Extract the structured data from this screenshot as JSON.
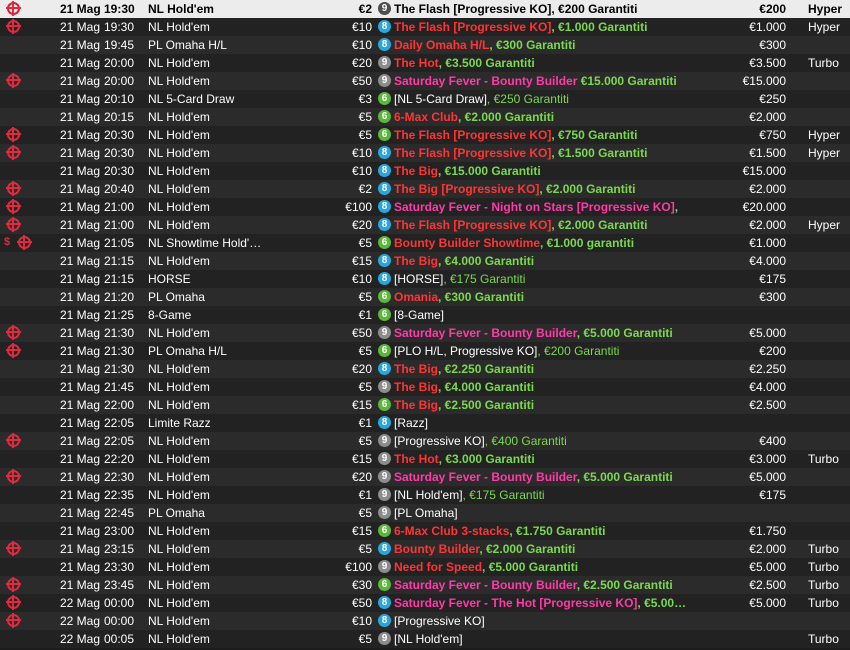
{
  "colors": {
    "seat_9": "#8c8c8c",
    "seat_8": "#29a7dc",
    "seat_6": "#5cb63a",
    "name_red": "#ff3535",
    "name_pink": "#ff3ba8",
    "guarantee_green": "#7cd94f",
    "reticle_red": "#e02a3e"
  },
  "rows": [
    {
      "reticle": true,
      "day": "21 Mag",
      "time": "19:30",
      "game": "NL Hold'em",
      "buyin": "€2",
      "seats": "9",
      "name": "The Flash [Progressive KO]",
      "suffix": ", €200 Garantiti",
      "name_style": "dark",
      "suffix_style": "dark",
      "gtd": "€200",
      "type": "Hyper",
      "selected": true
    },
    {
      "reticle": true,
      "day": "21 Mag",
      "time": "19:30",
      "game": "NL Hold'em",
      "buyin": "€10",
      "seats": "8",
      "name": "The Flash [Progressive KO]",
      "suffix": ", €1.000 Garantiti",
      "name_style": "red",
      "suffix_style": "green",
      "gtd": "€1.000",
      "type": "Hyper"
    },
    {
      "day": "21 Mag",
      "time": "19:45",
      "game": "PL Omaha H/L",
      "buyin": "€10",
      "seats": "8",
      "name": "Daily Omaha H/L",
      "suffix": ", €300 Garantiti",
      "name_style": "red",
      "suffix_style": "green",
      "gtd": "€300",
      "type": ""
    },
    {
      "day": "21 Mag",
      "time": "20:00",
      "game": "NL Hold'em",
      "buyin": "€20",
      "seats": "9",
      "name": "The Hot",
      "suffix": ", €3.500 Garantiti",
      "name_style": "red",
      "suffix_style": "green",
      "gtd": "€3.500",
      "type": "Turbo"
    },
    {
      "reticle": true,
      "day": "21 Mag",
      "time": "20:00",
      "game": "NL Hold'em",
      "buyin": "€50",
      "seats": "9",
      "name": "Saturday Fever - Bounty Builder",
      "suffix": " €15.000 Garantiti",
      "name_style": "pink",
      "suffix_style": "green",
      "gtd": "€15.000",
      "type": ""
    },
    {
      "day": "21 Mag",
      "time": "20:10",
      "game": "NL 5-Card Draw",
      "buyin": "€3",
      "seats": "6",
      "name": "[NL 5-Card Draw]",
      "suffix": ", €250 Garantiti",
      "name_style": "white",
      "suffix_style": "lite",
      "gtd": "€250",
      "type": ""
    },
    {
      "day": "21 Mag",
      "time": "20:15",
      "game": "NL Hold'em",
      "buyin": "€5",
      "seats": "6",
      "name": "6-Max Club",
      "suffix": ", €2.000 Garantiti",
      "name_style": "red",
      "suffix_style": "green",
      "gtd": "€2.000",
      "type": ""
    },
    {
      "reticle": true,
      "day": "21 Mag",
      "time": "20:30",
      "game": "NL Hold'em",
      "buyin": "€5",
      "seats": "6",
      "name": "The Flash [Progressive KO]",
      "suffix": ", €750 Garantiti",
      "name_style": "red",
      "suffix_style": "green",
      "gtd": "€750",
      "type": "Hyper"
    },
    {
      "reticle": true,
      "day": "21 Mag",
      "time": "20:30",
      "game": "NL Hold'em",
      "buyin": "€10",
      "seats": "8",
      "name": "The Flash [Progressive KO]",
      "suffix": ", €1.500 Garantiti",
      "name_style": "red",
      "suffix_style": "green",
      "gtd": "€1.500",
      "type": "Hyper"
    },
    {
      "day": "21 Mag",
      "time": "20:30",
      "game": "NL Hold'em",
      "buyin": "€10",
      "seats": "8",
      "name": "The Big",
      "suffix": ", €15.000 Garantiti",
      "name_style": "red",
      "suffix_style": "green",
      "gtd": "€15.000",
      "type": ""
    },
    {
      "reticle": true,
      "day": "21 Mag",
      "time": "20:40",
      "game": "NL Hold'em",
      "buyin": "€2",
      "seats": "8",
      "name": "The Big [Progressive KO]",
      "suffix": ", €2.000 Garantiti",
      "name_style": "red",
      "suffix_style": "green",
      "gtd": "€2.000",
      "type": ""
    },
    {
      "reticle": true,
      "day": "21 Mag",
      "time": "21:00",
      "game": "NL Hold'em",
      "buyin": "€100",
      "seats": "8",
      "name": "Saturday Fever - Night on Stars [Progressive KO]",
      "suffix": ",",
      "name_style": "pink",
      "suffix_style": "green",
      "gtd": "€20.000",
      "type": ""
    },
    {
      "reticle": true,
      "day": "21 Mag",
      "time": "21:00",
      "game": "NL Hold'em",
      "buyin": "€20",
      "seats": "8",
      "name": "The Flash [Progressive KO]",
      "suffix": ", €2.000 Garantiti",
      "name_style": "red",
      "suffix_style": "green",
      "gtd": "€2.000",
      "type": "Hyper"
    },
    {
      "reticle": true,
      "bounty": "$",
      "day": "21 Mag",
      "time": "21:05",
      "game": "NL Showtime Hold'…",
      "buyin": "€5",
      "seats": "6",
      "name": "Bounty Builder Showtime",
      "suffix": ", €1.000 garantiti",
      "name_style": "red",
      "suffix_style": "green",
      "gtd": "€1.000",
      "type": ""
    },
    {
      "day": "21 Mag",
      "time": "21:15",
      "game": "NL Hold'em",
      "buyin": "€15",
      "seats": "8",
      "name": "The Big",
      "suffix": ", €4.000 Garantiti",
      "name_style": "red",
      "suffix_style": "green",
      "gtd": "€4.000",
      "type": ""
    },
    {
      "day": "21 Mag",
      "time": "21:15",
      "game": "HORSE",
      "buyin": "€10",
      "seats": "8",
      "name": "[HORSE]",
      "suffix": ", €175 Garantiti",
      "name_style": "white",
      "suffix_style": "lite",
      "gtd": "€175",
      "type": ""
    },
    {
      "day": "21 Mag",
      "time": "21:20",
      "game": "PL Omaha",
      "buyin": "€5",
      "seats": "6",
      "name": "Omania",
      "suffix": ", €300 Garantiti",
      "name_style": "red",
      "suffix_style": "green",
      "gtd": "€300",
      "type": ""
    },
    {
      "day": "21 Mag",
      "time": "21:25",
      "game": "8-Game",
      "buyin": "€1",
      "seats": "6",
      "name": "[8-Game]",
      "suffix": "",
      "name_style": "white",
      "suffix_style": "lite",
      "gtd": "",
      "type": ""
    },
    {
      "reticle": true,
      "day": "21 Mag",
      "time": "21:30",
      "game": "NL Hold'em",
      "buyin": "€50",
      "seats": "9",
      "name": "Saturday Fever - Bounty Builder",
      "suffix": ", €5.000 Garantiti",
      "name_style": "pink",
      "suffix_style": "green",
      "gtd": "€5.000",
      "type": ""
    },
    {
      "reticle": true,
      "day": "21 Mag",
      "time": "21:30",
      "game": "PL Omaha H/L",
      "buyin": "€5",
      "seats": "6",
      "name": "[PLO H/L, Progressive KO]",
      "suffix": ", €200 Garantiti",
      "name_style": "white",
      "suffix_style": "lite",
      "gtd": "€200",
      "type": ""
    },
    {
      "day": "21 Mag",
      "time": "21:30",
      "game": "NL Hold'em",
      "buyin": "€20",
      "seats": "8",
      "name": "The Big",
      "suffix": ", €2.250 Garantiti",
      "name_style": "red",
      "suffix_style": "green",
      "gtd": "€2.250",
      "type": ""
    },
    {
      "day": "21 Mag",
      "time": "21:45",
      "game": "NL Hold'em",
      "buyin": "€5",
      "seats": "9",
      "name": "The Big",
      "suffix": ", €4.000 Garantiti",
      "name_style": "red",
      "suffix_style": "green",
      "gtd": "€4.000",
      "type": ""
    },
    {
      "day": "21 Mag",
      "time": "22:00",
      "game": "NL Hold'em",
      "buyin": "€15",
      "seats": "6",
      "name": "The Big",
      "suffix": ", €2.500 Garantiti",
      "name_style": "red",
      "suffix_style": "green",
      "gtd": "€2.500",
      "type": ""
    },
    {
      "day": "21 Mag",
      "time": "22:05",
      "game": "Limite Razz",
      "buyin": "€1",
      "seats": "8",
      "name": "[Razz]",
      "suffix": "",
      "name_style": "white",
      "suffix_style": "lite",
      "gtd": "",
      "type": ""
    },
    {
      "reticle": true,
      "day": "21 Mag",
      "time": "22:05",
      "game": "NL Hold'em",
      "buyin": "€5",
      "seats": "9",
      "name": "[Progressive KO]",
      "suffix": ", €400 Garantiti",
      "name_style": "white",
      "suffix_style": "lite",
      "gtd": "€400",
      "type": ""
    },
    {
      "day": "21 Mag",
      "time": "22:20",
      "game": "NL Hold'em",
      "buyin": "€15",
      "seats": "9",
      "name": "The Hot",
      "suffix": ", €3.000 Garantiti",
      "name_style": "red",
      "suffix_style": "green",
      "gtd": "€3.000",
      "type": "Turbo"
    },
    {
      "reticle": true,
      "day": "21 Mag",
      "time": "22:30",
      "game": "NL Hold'em",
      "buyin": "€20",
      "seats": "9",
      "name": "Saturday Fever - Bounty Builder",
      "suffix": ", €5.000 Garantiti",
      "name_style": "pink",
      "suffix_style": "green",
      "gtd": "€5.000",
      "type": ""
    },
    {
      "day": "21 Mag",
      "time": "22:35",
      "game": "NL Hold'em",
      "buyin": "€1",
      "seats": "9",
      "name": "[NL Hold'em]",
      "suffix": ", €175 Garantiti",
      "name_style": "white",
      "suffix_style": "lite",
      "gtd": "€175",
      "type": ""
    },
    {
      "day": "21 Mag",
      "time": "22:45",
      "game": "PL Omaha",
      "buyin": "€5",
      "seats": "9",
      "name": "[PL Omaha]",
      "suffix": "",
      "name_style": "white",
      "suffix_style": "lite",
      "gtd": "",
      "type": ""
    },
    {
      "day": "21 Mag",
      "time": "23:00",
      "game": "NL Hold'em",
      "buyin": "€15",
      "seats": "6",
      "name": "6-Max Club 3-stacks",
      "suffix": ", €1.750 Garantiti",
      "name_style": "red",
      "suffix_style": "green",
      "gtd": "€1.750",
      "type": ""
    },
    {
      "reticle": true,
      "day": "21 Mag",
      "time": "23:15",
      "game": "NL Hold'em",
      "buyin": "€5",
      "seats": "8",
      "name": "Bounty Builder",
      "suffix": ", €2.000 Garantiti",
      "name_style": "red",
      "suffix_style": "green",
      "gtd": "€2.000",
      "type": "Turbo"
    },
    {
      "day": "21 Mag",
      "time": "23:30",
      "game": "NL Hold'em",
      "buyin": "€100",
      "seats": "9",
      "name": "Need for Speed",
      "suffix": ", €5.000 Garantiti",
      "name_style": "red",
      "suffix_style": "green",
      "gtd": "€5.000",
      "type": "Turbo"
    },
    {
      "reticle": true,
      "day": "21 Mag",
      "time": "23:45",
      "game": "NL Hold'em",
      "buyin": "€30",
      "seats": "6",
      "name": "Saturday Fever - Bounty Builder",
      "suffix": ", €2.500 Garantiti",
      "name_style": "pink",
      "suffix_style": "green",
      "gtd": "€2.500",
      "type": "Turbo"
    },
    {
      "reticle": true,
      "day": "22 Mag",
      "time": "00:00",
      "game": "NL Hold'em",
      "buyin": "€50",
      "seats": "8",
      "name": "Saturday Fever - The Hot [Progressive KO]",
      "suffix": ", €5.00…",
      "name_style": "pink",
      "suffix_style": "green",
      "gtd": "€5.000",
      "type": "Turbo"
    },
    {
      "reticle": true,
      "day": "22 Mag",
      "time": "00:00",
      "game": "NL Hold'em",
      "buyin": "€10",
      "seats": "8",
      "name": "[Progressive KO]",
      "suffix": "",
      "name_style": "white",
      "suffix_style": "lite",
      "gtd": "",
      "type": ""
    },
    {
      "day": "22 Mag",
      "time": "00:05",
      "game": "NL Hold'em",
      "buyin": "€5",
      "seats": "9",
      "name": "[NL Hold'em]",
      "suffix": "",
      "name_style": "white",
      "suffix_style": "lite",
      "gtd": "",
      "type": "Turbo"
    }
  ]
}
